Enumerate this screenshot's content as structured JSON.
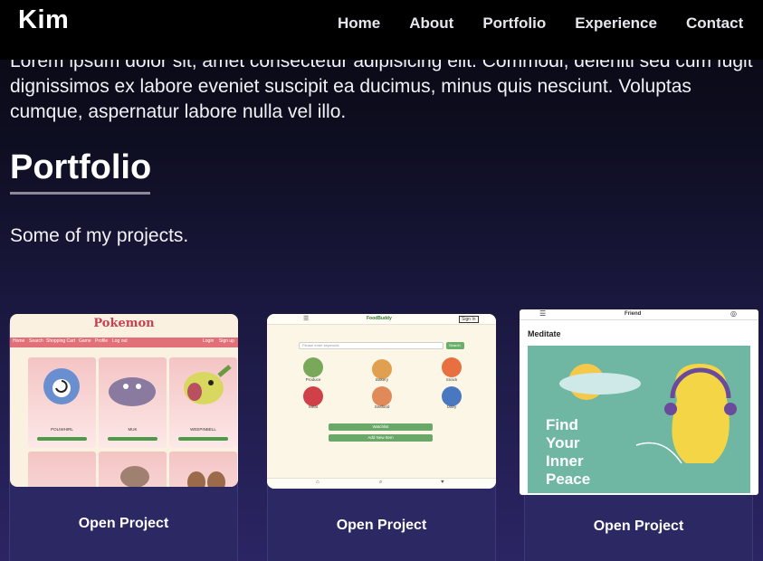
{
  "nav": {
    "logo": "Kim",
    "links": [
      "Home",
      "About",
      "Portfolio",
      "Experience",
      "Contact"
    ]
  },
  "intro": {
    "text": "Lorem ipsum dolor sit, amet consectetur adipisicing elit. Commodi, deleniti sed cum fugit dignissimos ex labore eveniet suscipit ea ducimus, minus quis nesciunt. Voluptas cumque, aspernatur labore nulla vel illo."
  },
  "portfolio": {
    "heading": "Portfolio",
    "subtitle": "Some of my projects."
  },
  "projects": [
    {
      "button": "Open Project",
      "shot": {
        "title": "Pokemon",
        "nav": [
          "Home",
          "Search",
          "Shopping Cart",
          "Game",
          "Profile",
          "Log out"
        ],
        "nav_right": [
          "Login",
          "Sign up"
        ],
        "names": [
          "POLIWHIRL",
          "MUK",
          "WEEPINBELL"
        ],
        "button_text": "Add to Cart"
      }
    },
    {
      "button": "Open Project",
      "shot": {
        "brand": "FoodBuddy",
        "signin": "Sign In",
        "search_placeholder": "Please enter keywords",
        "search_button": "Search",
        "categories": [
          "Produce",
          "Bakery",
          "Snack",
          "Meat",
          "Seafood",
          "Dairy"
        ],
        "buttons": [
          "Watchlist",
          "Add New Item"
        ]
      }
    },
    {
      "button": "Open Project",
      "shot": {
        "brand": "Friend",
        "section": "Meditate",
        "hero_lines": [
          "Find",
          "Your",
          "Inner",
          "Peace"
        ]
      }
    }
  ],
  "colors": {
    "navbar": "#000000",
    "card_bg": "#2b2864",
    "underline": "#8a8a9a"
  }
}
